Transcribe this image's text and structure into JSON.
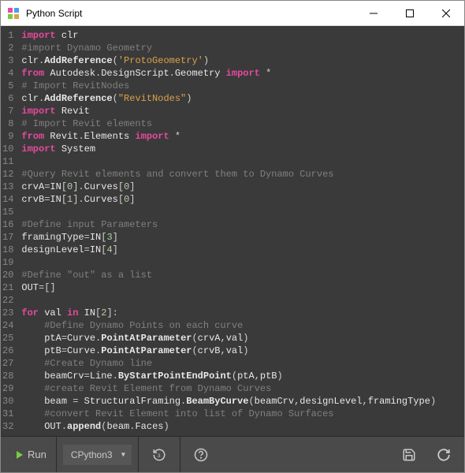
{
  "window": {
    "title": "Python Script"
  },
  "code": {
    "lines": [
      [
        {
          "t": "kw",
          "v": "import"
        },
        {
          "t": "id",
          "v": " clr"
        }
      ],
      [
        {
          "t": "cmt",
          "v": "#import Dynamo Geometry"
        }
      ],
      [
        {
          "t": "id",
          "v": "clr"
        },
        {
          "t": "brk",
          "v": "."
        },
        {
          "t": "fn",
          "v": "AddReference"
        },
        {
          "t": "brk",
          "v": "("
        },
        {
          "t": "str",
          "v": "'ProtoGeometry'"
        },
        {
          "t": "brk",
          "v": ")"
        }
      ],
      [
        {
          "t": "kw",
          "v": "from"
        },
        {
          "t": "id",
          "v": " Autodesk"
        },
        {
          "t": "brk",
          "v": "."
        },
        {
          "t": "id",
          "v": "DesignScript"
        },
        {
          "t": "brk",
          "v": "."
        },
        {
          "t": "id",
          "v": "Geometry "
        },
        {
          "t": "kw",
          "v": "import"
        },
        {
          "t": "id",
          "v": " "
        },
        {
          "t": "brk",
          "v": "*"
        }
      ],
      [
        {
          "t": "cmt",
          "v": "# Import RevitNodes"
        }
      ],
      [
        {
          "t": "id",
          "v": "clr"
        },
        {
          "t": "brk",
          "v": "."
        },
        {
          "t": "fn",
          "v": "AddReference"
        },
        {
          "t": "brk",
          "v": "("
        },
        {
          "t": "str",
          "v": "\"RevitNodes\""
        },
        {
          "t": "brk",
          "v": ")"
        }
      ],
      [
        {
          "t": "kw",
          "v": "import"
        },
        {
          "t": "id",
          "v": " Revit"
        }
      ],
      [
        {
          "t": "cmt",
          "v": "# Import Revit elements"
        }
      ],
      [
        {
          "t": "kw",
          "v": "from"
        },
        {
          "t": "id",
          "v": " Revit"
        },
        {
          "t": "brk",
          "v": "."
        },
        {
          "t": "id",
          "v": "Elements "
        },
        {
          "t": "kw",
          "v": "import"
        },
        {
          "t": "id",
          "v": " "
        },
        {
          "t": "brk",
          "v": "*"
        }
      ],
      [
        {
          "t": "kw",
          "v": "import"
        },
        {
          "t": "id",
          "v": " System"
        }
      ],
      [],
      [
        {
          "t": "cmt",
          "v": "#Query Revit elements and convert them to Dynamo Curves"
        }
      ],
      [
        {
          "t": "id",
          "v": "crvA"
        },
        {
          "t": "brk",
          "v": "="
        },
        {
          "t": "id",
          "v": "IN"
        },
        {
          "t": "brk",
          "v": "["
        },
        {
          "t": "num",
          "v": "0"
        },
        {
          "t": "brk",
          "v": "]."
        },
        {
          "t": "id",
          "v": "Curves"
        },
        {
          "t": "brk",
          "v": "["
        },
        {
          "t": "num",
          "v": "0"
        },
        {
          "t": "brk",
          "v": "]"
        }
      ],
      [
        {
          "t": "id",
          "v": "crvB"
        },
        {
          "t": "brk",
          "v": "="
        },
        {
          "t": "id",
          "v": "IN"
        },
        {
          "t": "brk",
          "v": "["
        },
        {
          "t": "num",
          "v": "1"
        },
        {
          "t": "brk",
          "v": "]."
        },
        {
          "t": "id",
          "v": "Curves"
        },
        {
          "t": "brk",
          "v": "["
        },
        {
          "t": "num",
          "v": "0"
        },
        {
          "t": "brk",
          "v": "]"
        }
      ],
      [],
      [
        {
          "t": "cmt",
          "v": "#Define input Parameters"
        }
      ],
      [
        {
          "t": "id",
          "v": "framingType"
        },
        {
          "t": "brk",
          "v": "="
        },
        {
          "t": "id",
          "v": "IN"
        },
        {
          "t": "brk",
          "v": "["
        },
        {
          "t": "num",
          "v": "3"
        },
        {
          "t": "brk",
          "v": "]"
        }
      ],
      [
        {
          "t": "id",
          "v": "designLevel"
        },
        {
          "t": "brk",
          "v": "="
        },
        {
          "t": "id",
          "v": "IN"
        },
        {
          "t": "brk",
          "v": "["
        },
        {
          "t": "num",
          "v": "4"
        },
        {
          "t": "brk",
          "v": "]"
        }
      ],
      [],
      [
        {
          "t": "cmt",
          "v": "#Define \"out\" as a list"
        }
      ],
      [
        {
          "t": "id",
          "v": "OUT"
        },
        {
          "t": "brk",
          "v": "=[]"
        }
      ],
      [],
      [
        {
          "t": "kw",
          "v": "for"
        },
        {
          "t": "id",
          "v": " val "
        },
        {
          "t": "kw",
          "v": "in"
        },
        {
          "t": "id",
          "v": " IN"
        },
        {
          "t": "brk",
          "v": "["
        },
        {
          "t": "num",
          "v": "2"
        },
        {
          "t": "brk",
          "v": "]:"
        }
      ],
      [
        {
          "t": "id",
          "v": "    "
        },
        {
          "t": "cmt",
          "v": "#Define Dynamo Points on each curve"
        }
      ],
      [
        {
          "t": "id",
          "v": "    ptA"
        },
        {
          "t": "brk",
          "v": "="
        },
        {
          "t": "id",
          "v": "Curve"
        },
        {
          "t": "brk",
          "v": "."
        },
        {
          "t": "fn",
          "v": "PointAtParameter"
        },
        {
          "t": "brk",
          "v": "("
        },
        {
          "t": "id",
          "v": "crvA"
        },
        {
          "t": "brk",
          "v": ","
        },
        {
          "t": "id",
          "v": "val"
        },
        {
          "t": "brk",
          "v": ")"
        }
      ],
      [
        {
          "t": "id",
          "v": "    ptB"
        },
        {
          "t": "brk",
          "v": "="
        },
        {
          "t": "id",
          "v": "Curve"
        },
        {
          "t": "brk",
          "v": "."
        },
        {
          "t": "fn",
          "v": "PointAtParameter"
        },
        {
          "t": "brk",
          "v": "("
        },
        {
          "t": "id",
          "v": "crvB"
        },
        {
          "t": "brk",
          "v": ","
        },
        {
          "t": "id",
          "v": "val"
        },
        {
          "t": "brk",
          "v": ")"
        }
      ],
      [
        {
          "t": "id",
          "v": "    "
        },
        {
          "t": "cmt",
          "v": "#Create Dynamo line"
        }
      ],
      [
        {
          "t": "id",
          "v": "    beamCrv"
        },
        {
          "t": "brk",
          "v": "="
        },
        {
          "t": "id",
          "v": "Line"
        },
        {
          "t": "brk",
          "v": "."
        },
        {
          "t": "fn",
          "v": "ByStartPointEndPoint"
        },
        {
          "t": "brk",
          "v": "("
        },
        {
          "t": "id",
          "v": "ptA"
        },
        {
          "t": "brk",
          "v": ","
        },
        {
          "t": "id",
          "v": "ptB"
        },
        {
          "t": "brk",
          "v": ")"
        }
      ],
      [
        {
          "t": "id",
          "v": "    "
        },
        {
          "t": "cmt",
          "v": "#create Revit Element from Dynamo Curves"
        }
      ],
      [
        {
          "t": "id",
          "v": "    beam "
        },
        {
          "t": "brk",
          "v": "="
        },
        {
          "t": "id",
          "v": " StructuralFraming"
        },
        {
          "t": "brk",
          "v": "."
        },
        {
          "t": "fn",
          "v": "BeamByCurve"
        },
        {
          "t": "brk",
          "v": "("
        },
        {
          "t": "id",
          "v": "beamCrv"
        },
        {
          "t": "brk",
          "v": ","
        },
        {
          "t": "id",
          "v": "designLevel"
        },
        {
          "t": "brk",
          "v": ","
        },
        {
          "t": "id",
          "v": "framingType"
        },
        {
          "t": "brk",
          "v": ")"
        }
      ],
      [
        {
          "t": "id",
          "v": "    "
        },
        {
          "t": "cmt",
          "v": "#convert Revit Element into list of Dynamo Surfaces"
        }
      ],
      [
        {
          "t": "id",
          "v": "    OUT"
        },
        {
          "t": "brk",
          "v": "."
        },
        {
          "t": "fn",
          "v": "append"
        },
        {
          "t": "brk",
          "v": "("
        },
        {
          "t": "id",
          "v": "beam"
        },
        {
          "t": "brk",
          "v": "."
        },
        {
          "t": "id",
          "v": "Faces"
        },
        {
          "t": "brk",
          "v": ")"
        }
      ]
    ]
  },
  "statusbar": {
    "run_label": "Run",
    "engine": "CPython3"
  }
}
